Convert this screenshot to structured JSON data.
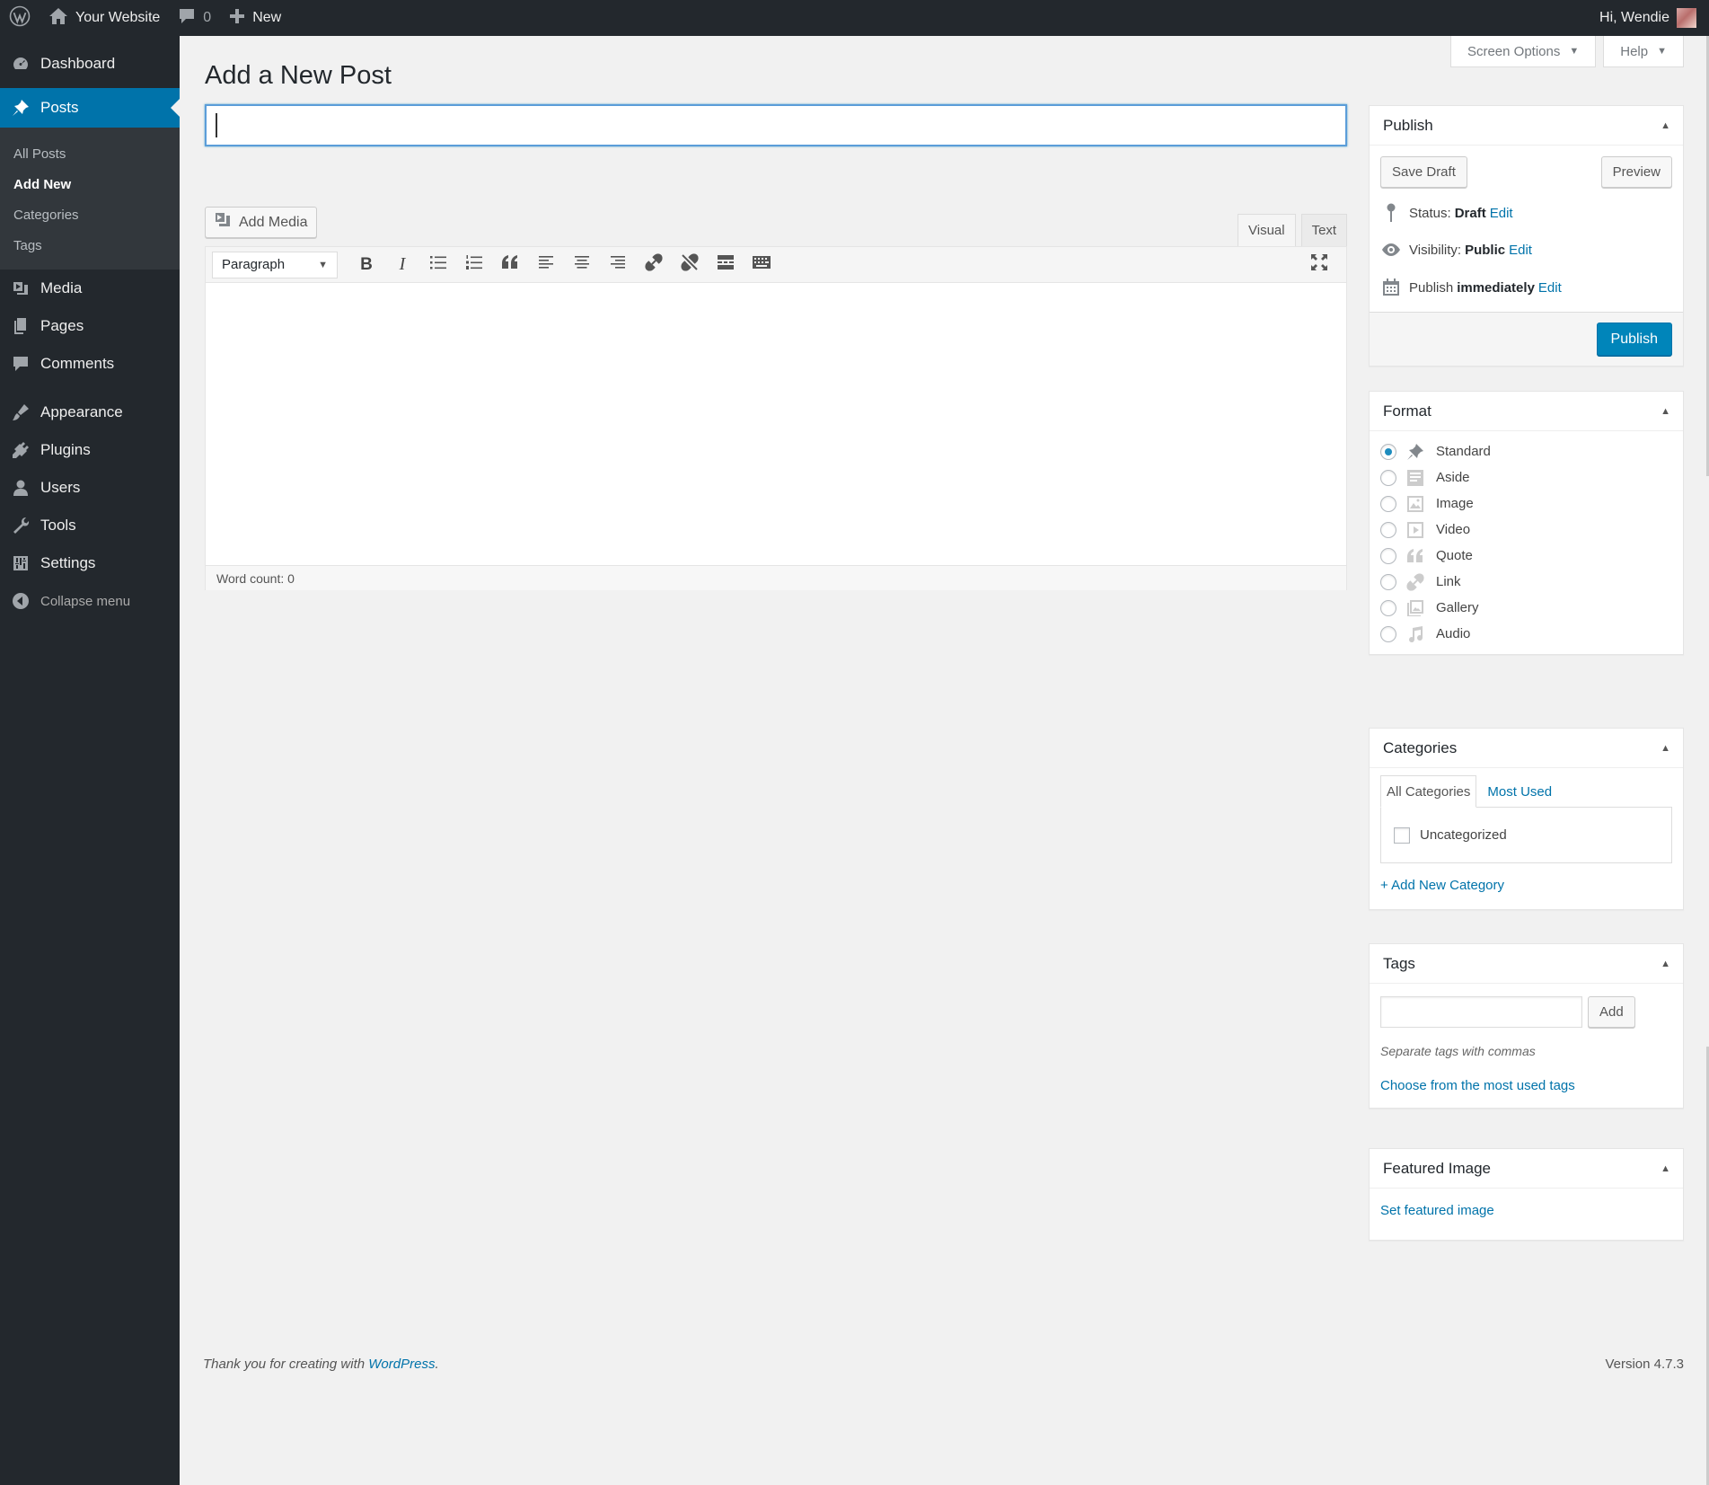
{
  "adminbar": {
    "site_name": "Your Website",
    "comments_count": "0",
    "new_label": "New",
    "greeting": "Hi, Wendie"
  },
  "sidebar": {
    "dashboard": "Dashboard",
    "posts": "Posts",
    "submenu": [
      "All Posts",
      "Add New",
      "Categories",
      "Tags"
    ],
    "media": "Media",
    "pages": "Pages",
    "comments": "Comments",
    "appearance": "Appearance",
    "plugins": "Plugins",
    "users": "Users",
    "tools": "Tools",
    "settings": "Settings",
    "collapse": "Collapse menu"
  },
  "screen_meta": {
    "screen_options": "Screen Options",
    "help": "Help"
  },
  "page": {
    "title": "Add a New Post",
    "post_title_value": ""
  },
  "editor": {
    "add_media": "Add Media",
    "tab_visual": "Visual",
    "tab_text": "Text",
    "format_selected": "Paragraph",
    "bold": "B",
    "italic": "I",
    "word_count": "Word count: 0"
  },
  "publish_box": {
    "title": "Publish",
    "save_draft": "Save Draft",
    "preview": "Preview",
    "status_label": "Status:",
    "status_value": "Draft",
    "visibility_label": "Visibility:",
    "visibility_value": "Public",
    "publish_label": "Publish",
    "publish_value": "immediately",
    "edit": "Edit",
    "publish_button": "Publish"
  },
  "format_box": {
    "title": "Format",
    "options": [
      "Standard",
      "Aside",
      "Image",
      "Video",
      "Quote",
      "Link",
      "Gallery",
      "Audio"
    ],
    "selected": "Standard"
  },
  "categories_box": {
    "title": "Categories",
    "tab_all": "All Categories",
    "tab_most_used": "Most Used",
    "items": [
      "Uncategorized"
    ],
    "add_new": "+ Add New Category"
  },
  "tags_box": {
    "title": "Tags",
    "input_value": "",
    "add_button": "Add",
    "hint": "Separate tags with commas",
    "choose_link": "Choose from the most used tags"
  },
  "featured_box": {
    "title": "Featured Image",
    "set_link": "Set featured image"
  },
  "footer": {
    "thanks_prefix": "Thank you for creating with ",
    "thanks_link": "WordPress",
    "thanks_suffix": ".",
    "version": "Version 4.7.3"
  },
  "colors": {
    "admin_bar_bg": "#23282d",
    "accent": "#0073aa",
    "primary_button": "#0085ba",
    "page_bg": "#f1f1f1"
  },
  "icons": {
    "adminbar": [
      "wordpress-logo-icon",
      "home-icon",
      "comment-icon",
      "plus-icon"
    ],
    "sidebar": [
      "dashboard-icon",
      "pin-icon",
      "media-icon",
      "pages-icon",
      "comments-icon",
      "appearance-icon",
      "plugins-icon",
      "users-icon",
      "tools-icon",
      "settings-icon",
      "collapse-icon"
    ]
  }
}
